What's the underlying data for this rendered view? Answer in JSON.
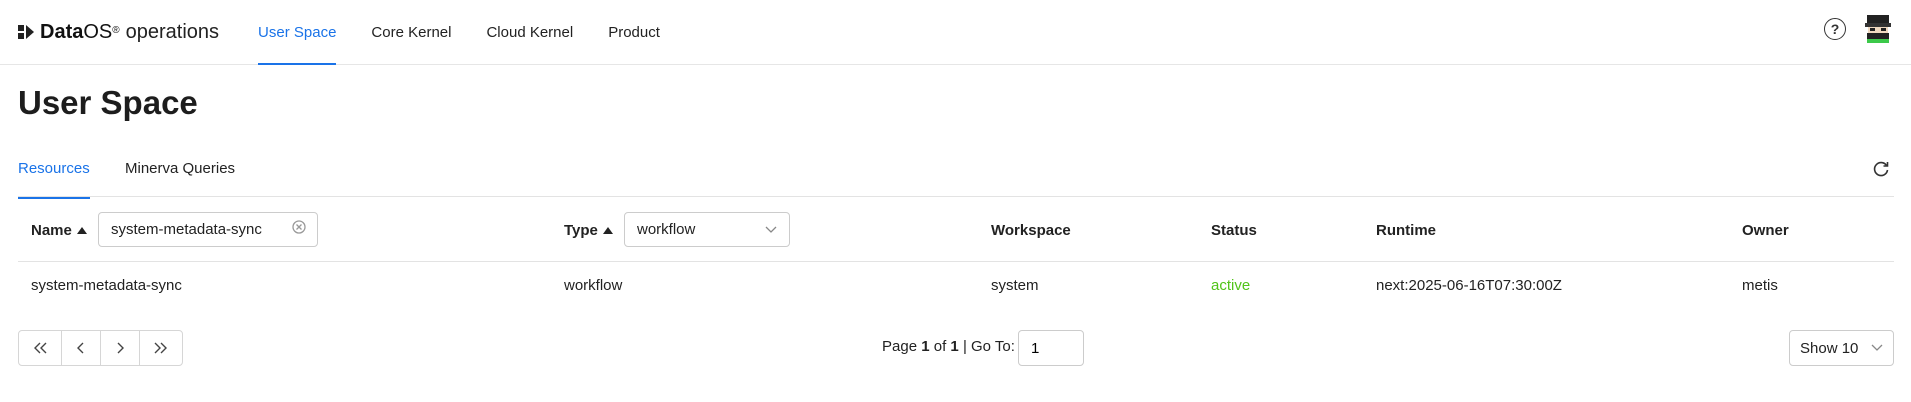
{
  "brand": {
    "name_bold": "Data",
    "name_os": "OS",
    "reg": "®",
    "suffix": "operations"
  },
  "nav": [
    {
      "label": "User Space",
      "active": true
    },
    {
      "label": "Core Kernel",
      "active": false
    },
    {
      "label": "Cloud Kernel",
      "active": false
    },
    {
      "label": "Product",
      "active": false
    }
  ],
  "header": {
    "help_icon": "?"
  },
  "page": {
    "title": "User Space"
  },
  "tabs": [
    {
      "label": "Resources",
      "active": true
    },
    {
      "label": "Minerva Queries",
      "active": false
    }
  ],
  "table": {
    "columns": {
      "name": "Name",
      "type": "Type",
      "workspace": "Workspace",
      "status": "Status",
      "runtime": "Runtime",
      "owner": "Owner"
    },
    "filters": {
      "name_value": "system-metadata-sync",
      "type_value": "workflow"
    },
    "rows": [
      {
        "name": "system-metadata-sync",
        "type": "workflow",
        "workspace": "system",
        "status": "active",
        "runtime": "next:2025-06-16T07:30:00Z",
        "owner": "metis"
      }
    ]
  },
  "pagination": {
    "page_label": "Page",
    "current": "1",
    "of_label": "of",
    "total": "1",
    "goto_label": "| Go To:",
    "goto_value": "1",
    "show_label": "Show 10"
  },
  "colors": {
    "accent": "#1a73e8",
    "status_active": "#52c41a"
  }
}
